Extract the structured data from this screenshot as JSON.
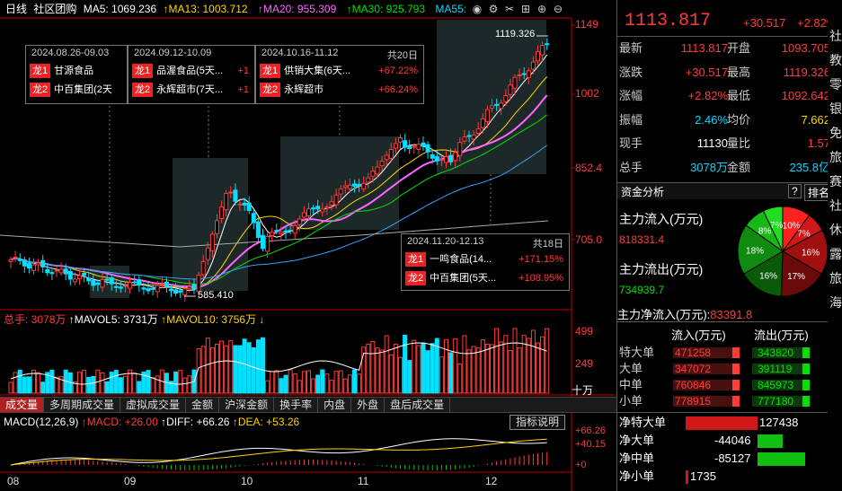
{
  "indicators": {
    "main_label": "日线",
    "stock_name": "社区团购",
    "ma5": "MA5: 1069.236",
    "ma13": "MA13: 1003.712",
    "ma20": "MA20: 955.309",
    "ma30": "MA30: 925.793",
    "ma55": "MA55:"
  },
  "price_axis": [
    "1149",
    "1002",
    "852.4",
    "705.0"
  ],
  "high_label": "1119.326",
  "low_label": "585.410",
  "leader_boxes": [
    {
      "period": "2024.08.26-09.03",
      "tag1": "龙1",
      "name1": "甘源食品",
      "tag2": "龙2",
      "name2": "中百集团(2天"
    },
    {
      "period": "2024.09.12-10.09",
      "tag1": "龙1",
      "name1": "品渥食品(5天...",
      "val1": "+1",
      "tag2": "龙2",
      "name2": "永辉超市(7天...",
      "val2": "+1"
    },
    {
      "period": "2024.10.16-11.12",
      "days": "共20日",
      "tag1": "龙1",
      "name1": "供销大集(6天...",
      "val1": "+67.22%",
      "tag2": "龙2",
      "name2": "永辉超市",
      "val2": "+66.24%"
    },
    {
      "period": "2024.11.20-12.13",
      "days": "共18日",
      "tag1": "龙1",
      "name1": "一鸣食品(14...",
      "val1": "+171.15%",
      "tag2": "龙2",
      "name2": "中百集团(5天...",
      "val2": "+108.95%"
    }
  ],
  "volume": {
    "total": "总手: 3078万",
    "mavol5": "MAVOL5: 3731万",
    "mavol10": "MAVOL10: 3756万",
    "axis": [
      "499",
      "249",
      "十万"
    ]
  },
  "tabs": [
    "成交量",
    "多周期成交量",
    "虚拟成交量",
    "金额",
    "沪深金额",
    "换手率",
    "内盘",
    "外盘",
    "盘后成交量"
  ],
  "macd": {
    "label": "MACD(12,26,9)",
    "macd": "MACD: +26.00",
    "diff": "DIFF: +66.26",
    "dea": "DEA: +53.26",
    "help": "指标说明",
    "axis": [
      "+66.26",
      "+40.15",
      "+0"
    ]
  },
  "x_axis": [
    "08",
    "09",
    "10",
    "11",
    "12"
  ],
  "right_panel": {
    "price": "1113.817",
    "change": "+30.517",
    "change_pct": "+2.82%",
    "quote_rows": [
      {
        "l1": "最新",
        "v1": "1113.817",
        "c1": "red",
        "l2": "开盘",
        "v2": "1093.705",
        "c2": "red"
      },
      {
        "l1": "涨跌",
        "v1": "+30.517",
        "c1": "red",
        "l2": "最高",
        "v2": "1119.326",
        "c2": "red"
      },
      {
        "l1": "涨幅",
        "v1": "+2.82%",
        "c1": "red",
        "l2": "最低",
        "v2": "1092.642",
        "c2": "red"
      },
      {
        "l1": "振幅",
        "v1": "2.46%",
        "c1": "cyan",
        "l2": "均价",
        "v2": "7.662",
        "c2": "yellow"
      },
      {
        "l1": "现手",
        "v1": "11130",
        "c1": "white",
        "l2": "量比",
        "v2": "1.57",
        "c2": "red"
      },
      {
        "l1": "总手",
        "v1": "3078万",
        "c1": "cyan",
        "l2": "金额",
        "v2": "235.8亿",
        "c2": "cyan"
      }
    ],
    "analysis_title": "资金分析",
    "help_btn": "?",
    "rank_btn": "排名",
    "inflow_label": "主力流入(万元)",
    "inflow_value": "818331.4",
    "outflow_label": "主力流出(万元)",
    "outflow_value": "734939.7",
    "net_label": "主力净流入(万元):",
    "net_value": "83391.8",
    "pie": [
      {
        "label": "10%",
        "value": 10,
        "color": "#ff2020"
      },
      {
        "label": "7%",
        "value": 7,
        "color": "#d01818"
      },
      {
        "label": "16%",
        "value": 16,
        "color": "#a01010"
      },
      {
        "label": "17%",
        "value": 17,
        "color": "#6a0a0a"
      },
      {
        "label": "16%",
        "value": 16,
        "color": "#0a5a0a"
      },
      {
        "label": "18%",
        "value": 18,
        "color": "#108a10"
      },
      {
        "label": "8%",
        "value": 8,
        "color": "#18b818"
      },
      {
        "label": "7%",
        "value": 7,
        "color": "#22dd22"
      }
    ],
    "flow_header_in": "流入(万元)",
    "flow_header_out": "流出(万元)",
    "flow_rows": [
      {
        "label": "特大单",
        "in": "471258",
        "out": "343820"
      },
      {
        "label": "大单",
        "in": "347072",
        "out": "391119"
      },
      {
        "label": "中单",
        "in": "760846",
        "out": "845973"
      },
      {
        "label": "小单",
        "in": "778915",
        "out": "777180"
      }
    ],
    "net_rows": [
      {
        "label": "净特大单",
        "value": "127438",
        "sign": 1
      },
      {
        "label": "净大单",
        "value": "-44046",
        "sign": -1
      },
      {
        "label": "净中单",
        "value": "-85127",
        "sign": -1
      },
      {
        "label": "净小单",
        "value": "1735",
        "sign": 1
      }
    ],
    "side_chars": [
      "社",
      "教",
      "零",
      "银",
      "免",
      "旅",
      "赛",
      "社",
      "休",
      "露",
      "旅",
      "海"
    ]
  },
  "colors": {
    "up": "#ff3b3b",
    "down": "#00e0ff",
    "ma5": "#ffffff",
    "ma13": "#ffd400",
    "ma20": "#ff66ff",
    "ma30": "#00e000"
  }
}
